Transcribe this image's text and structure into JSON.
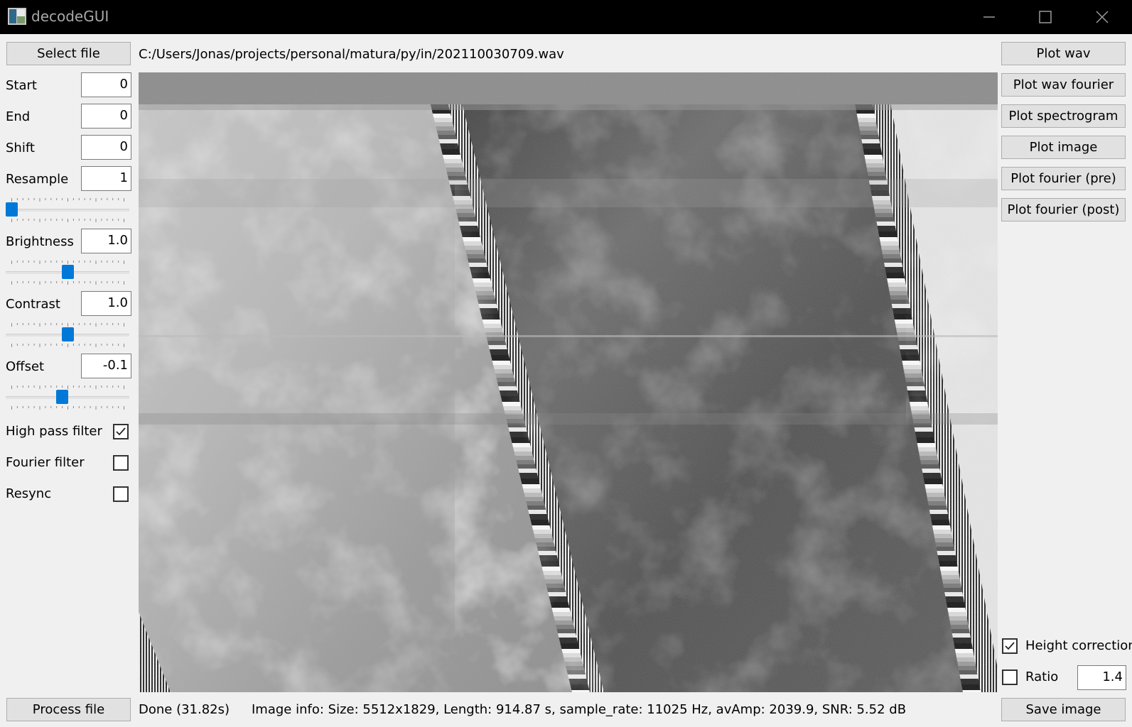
{
  "window": {
    "title": "decodeGUI"
  },
  "toolbar": {
    "select_file": "Select file",
    "file_path": "C:/Users/Jonas/projects/personal/matura/py/in/202110030709.wav"
  },
  "params": {
    "start": {
      "label": "Start",
      "value": "0"
    },
    "end": {
      "label": "End",
      "value": "0"
    },
    "shift": {
      "label": "Shift",
      "value": "0"
    },
    "resample": {
      "label": "Resample",
      "value": "1",
      "slider_level": 0.0
    },
    "brightness": {
      "label": "Brightness",
      "value": "1.0",
      "slider_level": 0.5
    },
    "contrast": {
      "label": "Contrast",
      "value": "1.0",
      "slider_level": 0.5
    },
    "offset": {
      "label": "Offset",
      "value": "-0.1",
      "slider_level": 0.45
    }
  },
  "filters": {
    "high_pass": {
      "label": "High pass filter",
      "checked": true
    },
    "fourier": {
      "label": "Fourier filter",
      "checked": false
    },
    "resync": {
      "label": "Resync",
      "checked": false
    }
  },
  "plot_buttons": {
    "wav": "Plot wav",
    "wav_fourier": "Plot wav fourier",
    "spectrogram": "Plot spectrogram",
    "image": "Plot image",
    "fourier_pre": "Plot fourier (pre)",
    "fourier_post": "Plot fourier (post)"
  },
  "output": {
    "height_correction": {
      "label": "Height correction",
      "checked": true
    },
    "ratio": {
      "label": "Ratio",
      "checked": false,
      "value": "1.4"
    },
    "save_image": "Save image"
  },
  "bottom": {
    "process_file": "Process file",
    "status": "Done (31.82s)",
    "image_info": "Image info: Size: 5512x1829,  Length: 914.87 s,  sample_rate: 11025 Hz,  avAmp: 2039.9,  SNR: 5.52 dB"
  },
  "colors": {
    "accent": "#0078d7",
    "titlebar": "#000000",
    "background": "#f0f0f0"
  }
}
